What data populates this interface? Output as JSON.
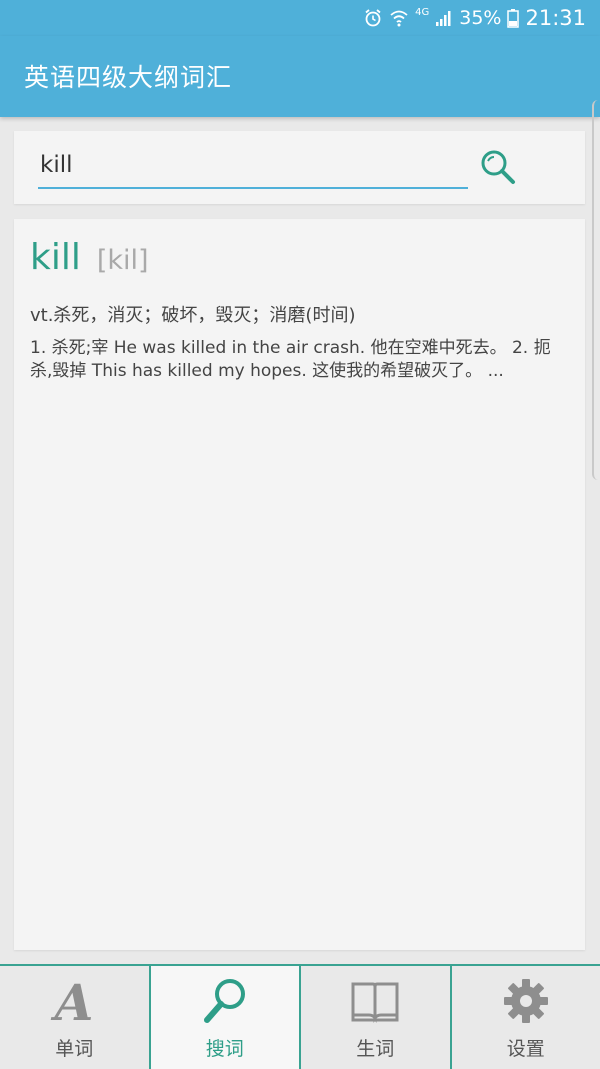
{
  "status_bar": {
    "network": "4G",
    "battery": "35%",
    "time": "21:31",
    "icons": [
      "alarm-icon",
      "wifi-icon",
      "signal-icon",
      "battery-icon"
    ]
  },
  "app_bar": {
    "title": "英语四级大纲词汇"
  },
  "search": {
    "value": "kill",
    "icon": "search-icon"
  },
  "result": {
    "word": "kill",
    "phonetic": "[kil]",
    "definition": "vt.杀死，消灭；破坏，毁灭；消磨(时间)",
    "examples": "1. 杀死;宰 He was killed in the air crash. 他在空难中死去。 2. 扼杀,毁掉 This has killed my hopes. 这使我的希望破灭了。 ..."
  },
  "bottom_nav": {
    "items": [
      {
        "label": "单词",
        "icon": "letter-a-icon",
        "active": false
      },
      {
        "label": "搜词",
        "icon": "search-icon",
        "active": true
      },
      {
        "label": "生词",
        "icon": "book-icon",
        "active": false
      },
      {
        "label": "设置",
        "icon": "gear-icon",
        "active": false
      }
    ]
  },
  "colors": {
    "primary": "#4fb0d9",
    "accent": "#2e9e88",
    "nav_border": "#3aa392"
  }
}
